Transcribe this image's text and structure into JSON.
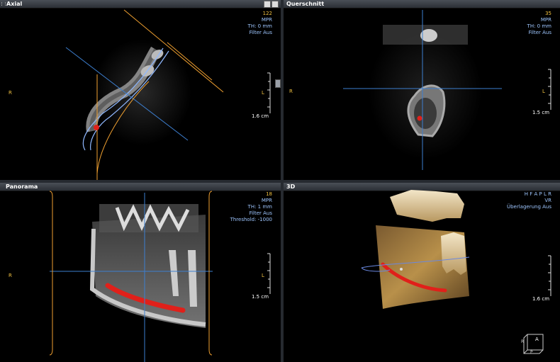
{
  "panes": {
    "axial": {
      "title": "Axial",
      "info": {
        "slice": "122",
        "mode": "MPR",
        "thickness": "TH: 0 mm",
        "filter": "Filter Aus"
      },
      "left_marker": "R",
      "right_marker": "L",
      "scale": "1.6 cm"
    },
    "cross": {
      "title": "Querschnitt",
      "info": {
        "slice": "35",
        "mode": "MPR",
        "thickness": "TH: 0 mm",
        "filter": "Filter Aus"
      },
      "left_marker": "R",
      "right_marker": "L",
      "scale": "1.5 cm"
    },
    "panorama": {
      "title": "Panorama",
      "info": {
        "slice": "18",
        "mode": "MPR",
        "thickness": "TH: 1 mm",
        "filter": "Filter Aus",
        "threshold": "Threshold: -1000"
      },
      "left_marker": "R",
      "right_marker": "L",
      "scale": "1.5 cm"
    },
    "threed": {
      "title": "3D",
      "info": {
        "orient": "H F A P L R",
        "mode": "VR",
        "overlay": "Überlagerung Aus"
      },
      "scale": "1.6 cm",
      "cube": {
        "face": "A",
        "left": "R",
        "bottom": "P"
      }
    }
  },
  "colors": {
    "title_text": "#ffffff",
    "info_blue": "#9ec6ff",
    "accent_yellow": "#f0c040",
    "crosshair_blue": "#3d7fd0",
    "nerve_red": "#e0201a",
    "guide_orange": "#f0a030"
  }
}
